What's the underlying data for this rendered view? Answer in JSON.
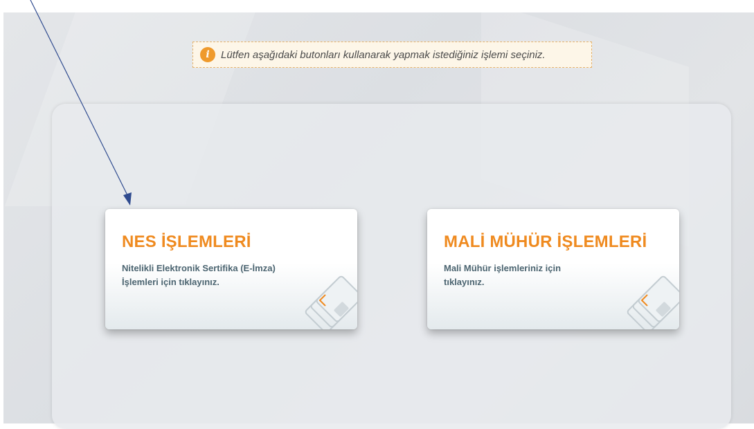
{
  "notice": {
    "icon": "info-icon",
    "icon_glyph": "i",
    "text": "Lütfen aşağıdaki butonları kullanarak yapmak istediğiniz işlemi seçiniz."
  },
  "cards": [
    {
      "title": "NES İŞLEMLERİ",
      "description": "Nitelikli Elektronik Sertifika (E-İmza) İşlemleri için tıklayınız.",
      "icon": "smart-card-icon"
    },
    {
      "title": "MALİ MÜHÜR İŞLEMLERİ",
      "description": "Mali Mühür işlemleriniz için tıklayınız.",
      "icon": "smart-card-icon"
    }
  ],
  "annotation": {
    "icon": "arrow-pointer-icon",
    "color": "#2f4b8f"
  },
  "colors": {
    "accent": "#ef8a1f",
    "description": "#4b6470",
    "notice_border": "#e6b26a",
    "notice_bg": "#fdf6e8"
  }
}
